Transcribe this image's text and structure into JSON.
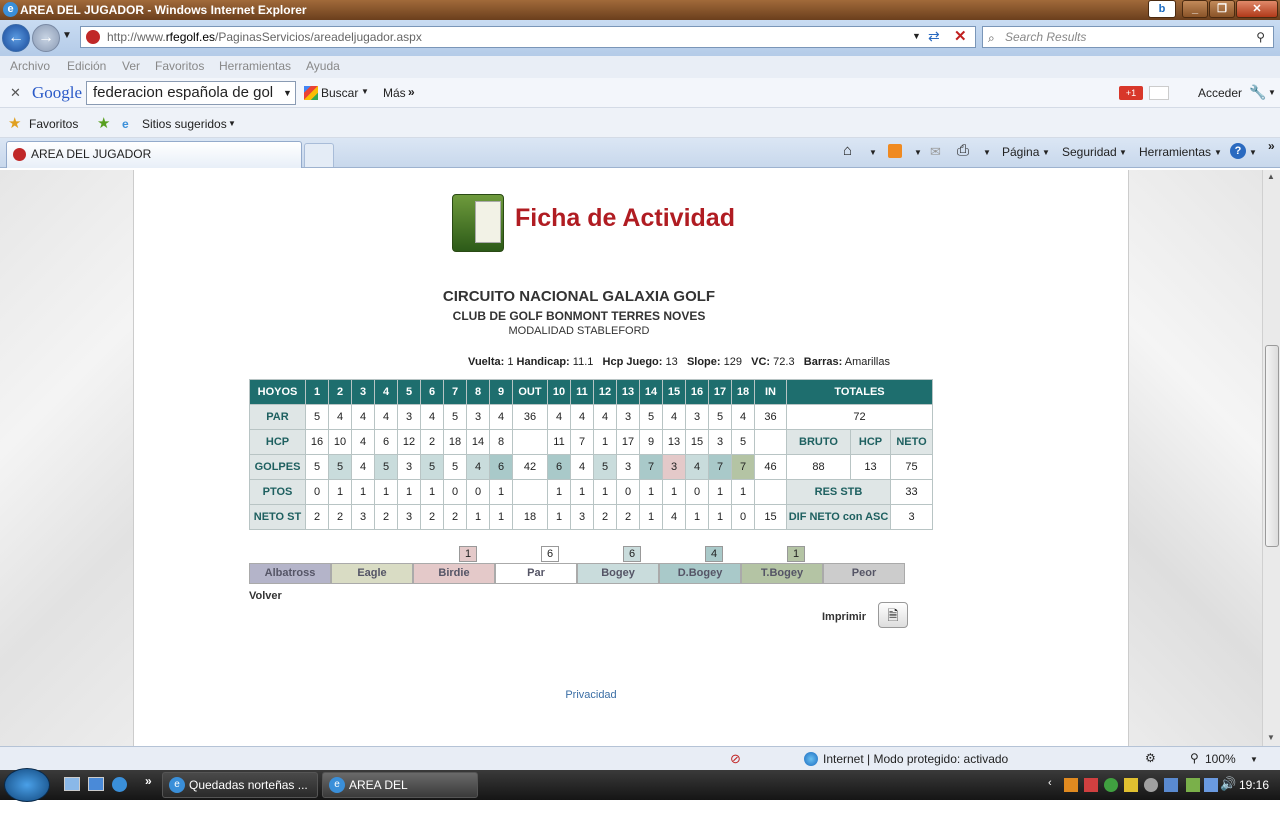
{
  "window": {
    "title": "AREA DEL JUGADOR - Windows Internet Explorer"
  },
  "address": {
    "prefix": "http://www.",
    "domain": "rfegolf.es",
    "path": "/PaginasServicios/areadeljugador.aspx",
    "search_placeholder": "Search Results"
  },
  "menu": [
    "Archivo",
    "Edición",
    "Ver",
    "Favoritos",
    "Herramientas",
    "Ayuda"
  ],
  "google": {
    "logo": "Google",
    "query": "federacion española de gol",
    "buscar": "Buscar",
    "mas": "Más",
    "gplus": "+1",
    "acceder": "Acceder"
  },
  "favbar": {
    "favoritos": "Favoritos",
    "sitios": "Sitios sugeridos"
  },
  "tab": {
    "title": "AREA DEL JUGADOR"
  },
  "commands": {
    "pagina": "Página",
    "seguridad": "Seguridad",
    "herramientas": "Herramientas"
  },
  "page": {
    "title": "Ficha de Actividad",
    "circuit": "CIRCUITO NACIONAL GALAXIA GOLF",
    "club": "CLUB DE GOLF BONMONT TERRES NOVES",
    "modalidad": "MODALIDAD STABLEFORD",
    "vuelta": {
      "l1": "Vuelta:",
      "v1": "1",
      "l2": "Handicap:",
      "v2": "11.1",
      "l3": "Hcp Juego:",
      "v3": "13",
      "l4": "Slope:",
      "v4": "129",
      "l5": "VC:",
      "v5": "72.3",
      "l6": "Barras:",
      "v6": "Amarillas"
    },
    "headers": {
      "hoyos": "HOYOS",
      "out": "OUT",
      "in": "IN",
      "totales": "TOTALES",
      "par": "PAR",
      "hcp": "HCP",
      "golpes": "GOLPES",
      "ptos": "PTOS",
      "neto": "NETO ST",
      "bruto": "BRUTO",
      "hcp2": "HCP",
      "neto2": "NETO",
      "resstb": "RES STB",
      "difneto": "DIF NETO con ASC"
    },
    "holes": [
      "1",
      "2",
      "3",
      "4",
      "5",
      "6",
      "7",
      "8",
      "9",
      "10",
      "11",
      "12",
      "13",
      "14",
      "15",
      "16",
      "17",
      "18"
    ],
    "par": [
      "5",
      "4",
      "4",
      "4",
      "3",
      "4",
      "5",
      "3",
      "4",
      "4",
      "4",
      "4",
      "3",
      "5",
      "4",
      "3",
      "5",
      "4"
    ],
    "par_out": "36",
    "par_in": "36",
    "par_total": "72",
    "hcp": [
      "16",
      "10",
      "4",
      "6",
      "12",
      "2",
      "18",
      "14",
      "8",
      "11",
      "7",
      "1",
      "17",
      "9",
      "13",
      "15",
      "3",
      "5"
    ],
    "golpes": [
      "5",
      "5",
      "4",
      "5",
      "3",
      "5",
      "5",
      "4",
      "6",
      "6",
      "4",
      "5",
      "3",
      "7",
      "3",
      "4",
      "7",
      "7"
    ],
    "golpes_out": "42",
    "golpes_in": "46",
    "golpes_class": [
      "",
      "c-bogey",
      "",
      "c-bogey",
      "",
      "c-bogey",
      "",
      "c-bogey",
      "c-dbogey",
      "c-dbogey",
      "",
      "c-bogey",
      "",
      "c-dbogey",
      "c-birdie",
      "c-bogey",
      "c-dbogey",
      "c-tbogey"
    ],
    "ptos": [
      "0",
      "1",
      "1",
      "1",
      "1",
      "1",
      "0",
      "0",
      "1",
      "1",
      "1",
      "1",
      "0",
      "1",
      "1",
      "0",
      "1",
      "1"
    ],
    "neto": [
      "2",
      "2",
      "3",
      "2",
      "3",
      "2",
      "2",
      "1",
      "1",
      "1",
      "3",
      "2",
      "2",
      "1",
      "4",
      "1",
      "1",
      "0"
    ],
    "neto_out": "18",
    "neto_in": "15",
    "totals": {
      "bruto": "88",
      "hcp": "13",
      "neto": "75",
      "resstb": "33",
      "difneto": "3"
    },
    "legend": [
      {
        "label": "Albatross",
        "cls": "c-alb",
        "count": ""
      },
      {
        "label": "Eagle",
        "cls": "c-eagle",
        "count": ""
      },
      {
        "label": "Birdie",
        "cls": "c-birdie",
        "count": "1"
      },
      {
        "label": "Par",
        "cls": "",
        "count": "6"
      },
      {
        "label": "Bogey",
        "cls": "c-bogey",
        "count": "6"
      },
      {
        "label": "D.Bogey",
        "cls": "c-dbogey",
        "count": "4"
      },
      {
        "label": "T.Bogey",
        "cls": "c-tbogey",
        "count": "1"
      },
      {
        "label": "Peor",
        "cls": "c-peor",
        "count": ""
      }
    ],
    "volver": "Volver",
    "imprimir": "Imprimir",
    "privacidad": "Privacidad"
  },
  "status": {
    "zone": "Internet | Modo protegido: activado",
    "zoom": "100%"
  },
  "taskbar": {
    "item1": "Quedadas norteñas ...",
    "item2": "AREA DEL JUGADOR...",
    "clock": "19:16"
  }
}
